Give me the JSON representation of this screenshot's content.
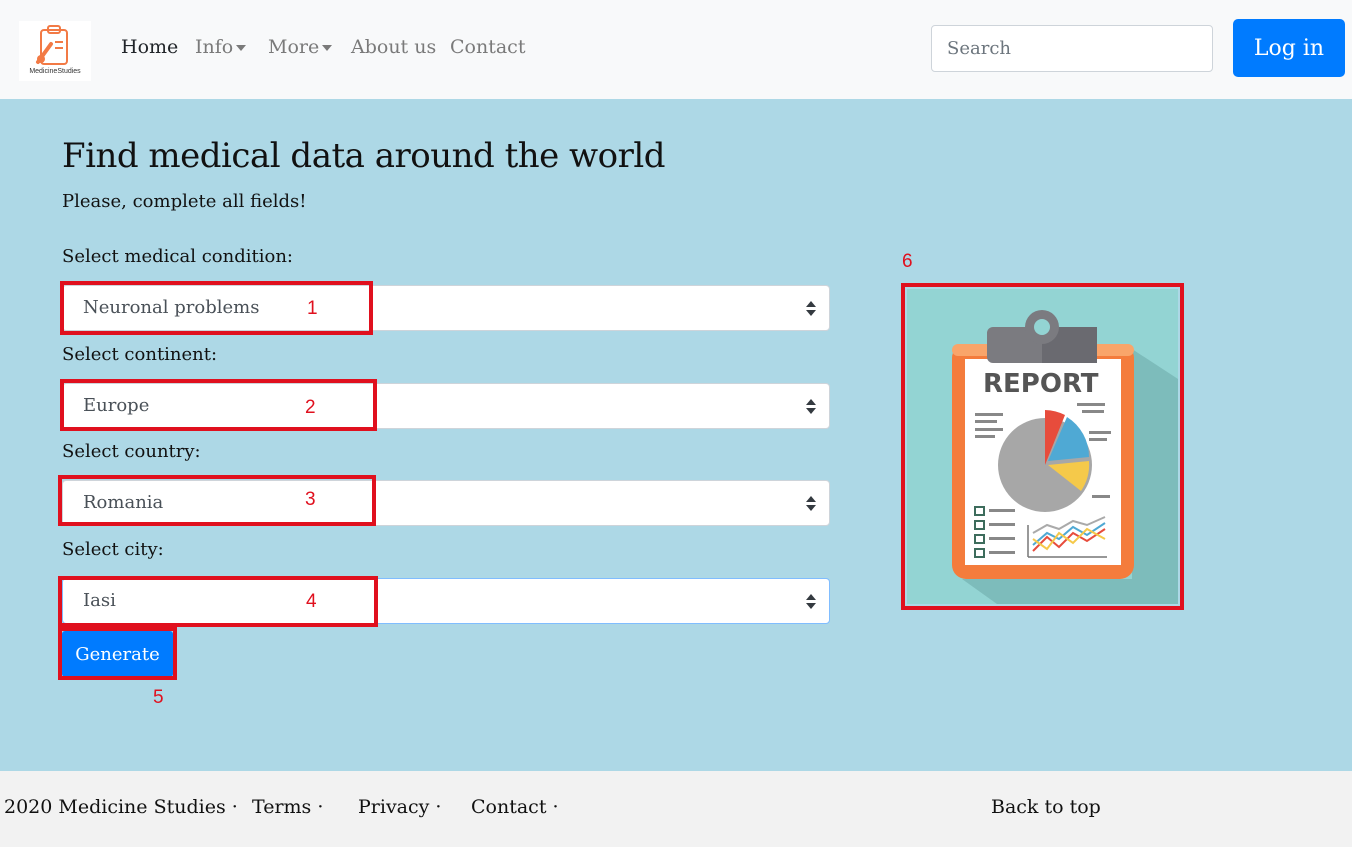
{
  "brand": {
    "name": "MedicineStudies",
    "color": "#f27a45"
  },
  "nav": {
    "home": "Home",
    "info": "Info",
    "more": "More",
    "about": "About us",
    "contact": "Contact"
  },
  "search": {
    "placeholder": "Search"
  },
  "login": {
    "label": "Log in"
  },
  "main": {
    "title": "Find medical data around the world",
    "subtitle": "Please, complete all fields!",
    "fields": [
      {
        "label": "Select medical condition:",
        "value": "Neuronal problems",
        "anno": "1"
      },
      {
        "label": "Select continent:",
        "value": "Europe",
        "anno": "2"
      },
      {
        "label": "Select country:",
        "value": "Romania",
        "anno": "3"
      },
      {
        "label": "Select city:",
        "value": "Iasi",
        "anno": "4"
      }
    ],
    "generate": {
      "label": "Generate",
      "anno": "5"
    },
    "report_image": {
      "text": "REPORT",
      "anno": "6"
    }
  },
  "footer": {
    "copyright": "2020 Medicine Studies ·",
    "terms": "Terms ·",
    "privacy": "Privacy ·",
    "contact": "Contact ·",
    "back_to_top": "Back to top"
  },
  "colors": {
    "primary": "#007bff",
    "background": "#add8e6",
    "annotation": "#e0101e"
  }
}
